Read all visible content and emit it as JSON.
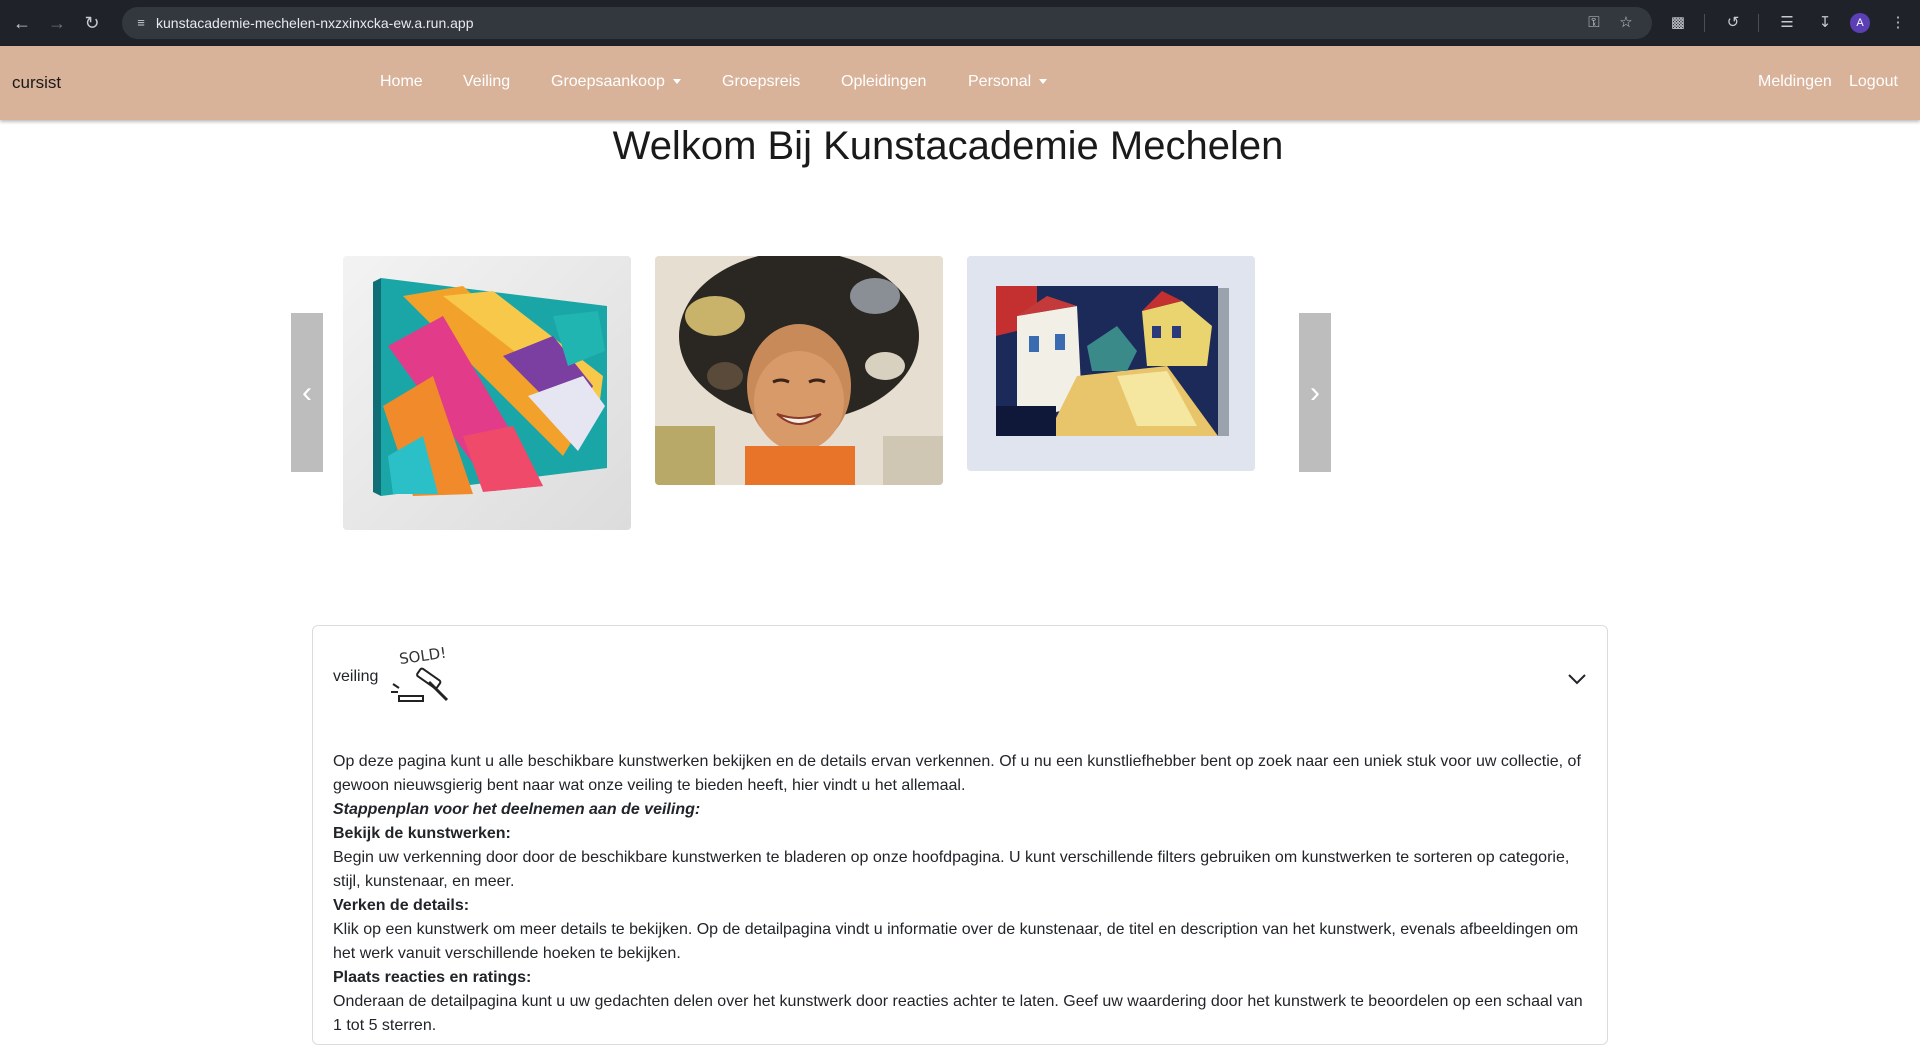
{
  "browser": {
    "url": "kunstacademie-mechelen-nxzxinxcka-ew.a.run.app",
    "profile_initial": "A",
    "icons": [
      "back-icon",
      "forward-icon",
      "reload-icon",
      "site-settings-icon",
      "password-key-icon",
      "bookmark-star-icon",
      "extensions-icon",
      "history-icon",
      "reading-list-icon",
      "download-icon",
      "menu-dots-icon"
    ]
  },
  "navbar": {
    "brand": "cursist",
    "links": {
      "home": "Home",
      "veiling": "Veiling",
      "groepsaankoop": "Groepsaankoop",
      "groepsreis": "Groepsreis",
      "opleidingen": "Opleidingen",
      "personal": "Personal"
    },
    "right": {
      "meldingen": "Meldingen",
      "logout": "Logout"
    },
    "background": "#d8b299"
  },
  "page": {
    "title": "Welkom Bij Kunstacademie Mechelen"
  },
  "carousel": {
    "prev_icon": "chevron-left-icon",
    "next_icon": "chevron-right-icon",
    "slides": [
      "abstract-colorful-canvas",
      "smiling-woman-painting",
      "village-street-painting"
    ]
  },
  "accordion": {
    "title": "veiling",
    "logo_text": "SOLD!",
    "intro": "Op deze pagina kunt u alle beschikbare kunstwerken bekijken en de details ervan verkennen. Of u nu een kunstliefhebber bent op zoek naar een uniek stuk voor uw collectie, of gewoon nieuwsgierig bent naar wat onze veiling te bieden heeft, hier vindt u het allemaal.",
    "steps_heading": "Stappenplan voor het deelnemen aan de veiling:",
    "step1_heading": "Bekijk de kunstwerken:",
    "step1_text": "Begin uw verkenning door door de beschikbare kunstwerken te bladeren op onze hoofdpagina. U kunt verschillende filters gebruiken om kunstwerken te sorteren op categorie, stijl, kunstenaar, en meer.",
    "step2_heading": "Verken de details:",
    "step2_text": "Klik op een kunstwerk om meer details te bekijken. Op de detailpagina vindt u informatie over de kunstenaar, de titel en description van het kunstwerk, evenals afbeeldingen om het werk vanuit verschillende hoeken te bekijken.",
    "step3_heading": "Plaats reacties en ratings:",
    "step3_text": "Onderaan de detailpagina kunt u uw gedachten delen over het kunstwerk door reacties achter te laten. Geef uw waardering door het kunstwerk te beoordelen op een schaal van 1 tot 5 sterren."
  }
}
